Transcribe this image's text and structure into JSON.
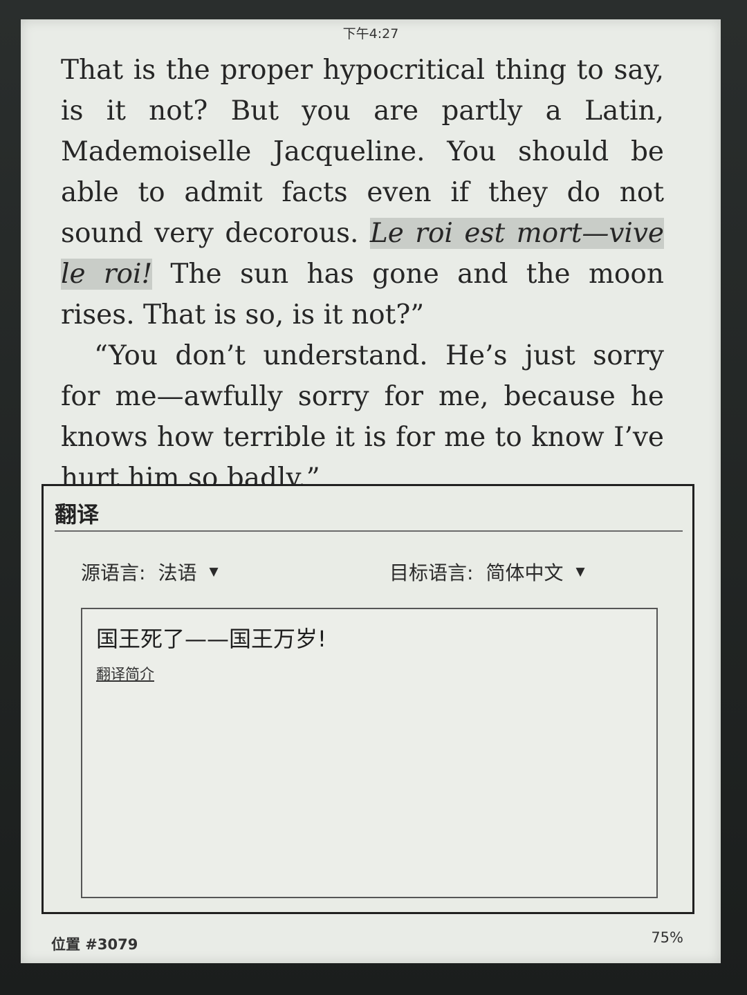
{
  "status_bar": {
    "time": "下午4:27"
  },
  "book": {
    "paragraph_1_before": "That is the proper hypocritical thing to say, is it not? But you are partly a Latin, Mademoiselle Jacqueline. You should be able to admit facts even if they do not sound very decorous. ",
    "highlighted_phrase": "Le roi est mort—vive le roi!",
    "paragraph_1_after": " The sun has gone and the moon rises. That is so, is it not?”",
    "paragraph_2": "“You don’t understand. He’s just sorry for me—awfully sorry for me, because he knows how terrible it is for me to know I’ve hurt him so badly.”"
  },
  "translate_dialog": {
    "title": "翻译",
    "source_label": "源语言:",
    "source_value": "法语",
    "target_label": "目标语言:",
    "target_value": "简体中文",
    "caret": "▼",
    "result": "国王死了——国王万岁!",
    "intro_link": "翻译简介"
  },
  "footer": {
    "location": "位置 #3079",
    "progress": "75%"
  }
}
